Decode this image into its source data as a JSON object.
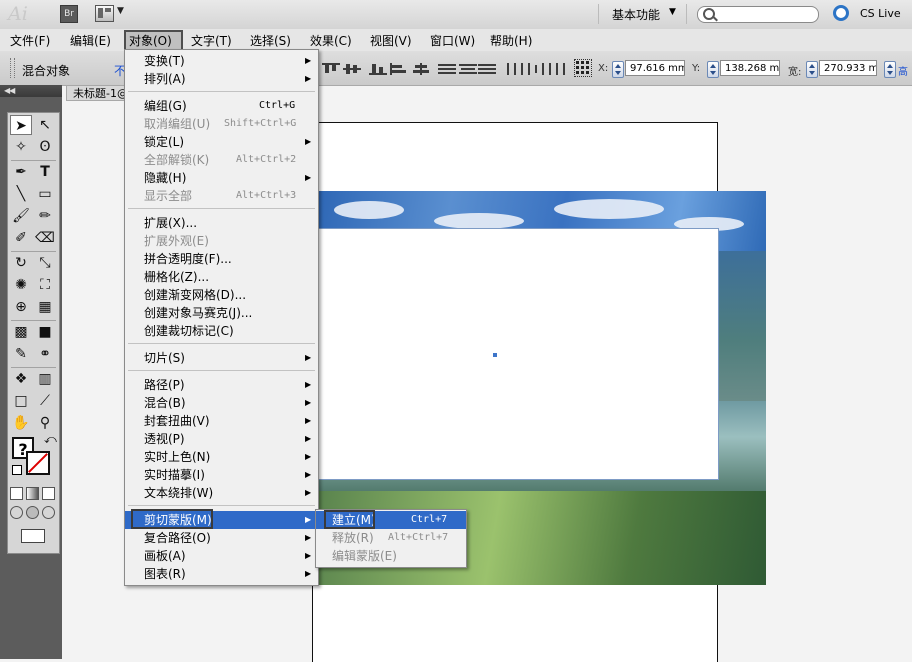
{
  "app": {
    "logo_text": "Ai",
    "bridge_label": "Br",
    "workspace": "基本功能",
    "cslive": "CS Live"
  },
  "menubar": [
    {
      "label": "文件(F)"
    },
    {
      "label": "编辑(E)"
    },
    {
      "label": "对象(O)"
    },
    {
      "label": "文字(T)"
    },
    {
      "label": "选择(S)"
    },
    {
      "label": "效果(C)"
    },
    {
      "label": "视图(V)"
    },
    {
      "label": "窗口(W)"
    },
    {
      "label": "帮助(H)"
    }
  ],
  "control_bar": {
    "label": "混合对象",
    "link": "不",
    "x_label": "X:",
    "x_value": "97.616 mm",
    "y_label": "Y:",
    "y_value": "138.268 mm",
    "w_label": "宽:",
    "w_value": "270.933 mr",
    "h_label": "高"
  },
  "document": {
    "tab_title": "未标题-1@"
  },
  "tools": {
    "fill_symbol": "?"
  },
  "object_menu": {
    "items": [
      {
        "label": "变换(T)",
        "submenu": true
      },
      {
        "label": "排列(A)",
        "submenu": true
      },
      {
        "label": "编组(G)",
        "shortcut": "Ctrl+G"
      },
      {
        "label": "取消编组(U)",
        "shortcut": "Shift+Ctrl+G",
        "disabled": true
      },
      {
        "label": "锁定(L)",
        "submenu": true
      },
      {
        "label": "全部解锁(K)",
        "shortcut": "Alt+Ctrl+2",
        "disabled": true
      },
      {
        "label": "隐藏(H)",
        "submenu": true
      },
      {
        "label": "显示全部",
        "shortcut": "Alt+Ctrl+3",
        "disabled": true
      },
      {
        "label": "扩展(X)..."
      },
      {
        "label": "扩展外观(E)",
        "disabled": true
      },
      {
        "label": "拼合透明度(F)..."
      },
      {
        "label": "栅格化(Z)..."
      },
      {
        "label": "创建渐变网格(D)..."
      },
      {
        "label": "创建对象马赛克(J)..."
      },
      {
        "label": "创建裁切标记(C)"
      },
      {
        "label": "切片(S)",
        "submenu": true
      },
      {
        "label": "路径(P)",
        "submenu": true
      },
      {
        "label": "混合(B)",
        "submenu": true
      },
      {
        "label": "封套扭曲(V)",
        "submenu": true
      },
      {
        "label": "透视(P)",
        "submenu": true
      },
      {
        "label": "实时上色(N)",
        "submenu": true
      },
      {
        "label": "实时描摹(I)",
        "submenu": true
      },
      {
        "label": "文本绕排(W)",
        "submenu": true
      },
      {
        "label": "剪切蒙版(M)",
        "submenu": true,
        "highlighted": true
      },
      {
        "label": "复合路径(O)",
        "submenu": true
      },
      {
        "label": "画板(A)",
        "submenu": true
      },
      {
        "label": "图表(R)",
        "submenu": true
      }
    ]
  },
  "clip_submenu": {
    "items": [
      {
        "label": "建立(M)",
        "shortcut": "Ctrl+7",
        "highlighted": true
      },
      {
        "label": "释放(R)",
        "shortcut": "Alt+Ctrl+7",
        "disabled": true
      },
      {
        "label": "编辑蒙版(E)",
        "disabled": true
      }
    ]
  },
  "colors": {
    "highlight": "#2f6ac8",
    "disabled_text": "#8c8c8c"
  }
}
